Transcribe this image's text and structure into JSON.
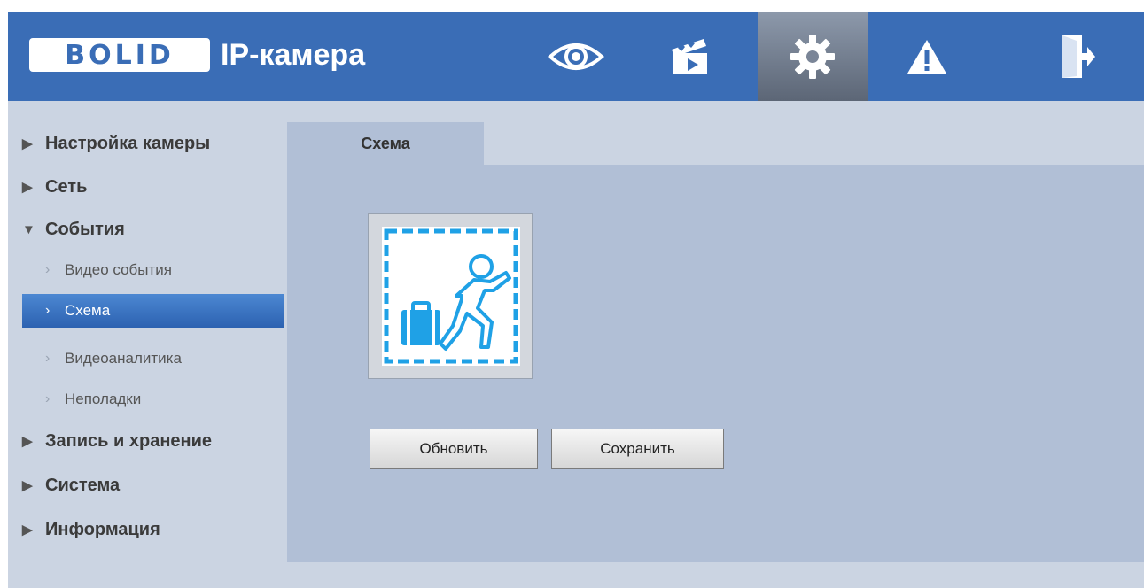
{
  "header": {
    "logo_letters": "BOLID",
    "title": "IP-камера",
    "nav": [
      {
        "icon": "eye-icon",
        "active": false
      },
      {
        "icon": "clapperboard-icon",
        "active": false
      },
      {
        "icon": "gear-icon",
        "active": true
      },
      {
        "icon": "warning-icon",
        "active": false
      },
      {
        "icon": "logout-icon",
        "active": false
      }
    ]
  },
  "sidebar": {
    "items": [
      {
        "label": "Настройка камеры",
        "expanded": false
      },
      {
        "label": "Сеть",
        "expanded": false
      },
      {
        "label": "События",
        "expanded": true,
        "children": [
          {
            "label": "Видео события",
            "active": false
          },
          {
            "label": "Схема",
            "active": true
          },
          {
            "label": "Видеоаналитика",
            "active": false
          },
          {
            "label": "Неполадки",
            "active": false
          }
        ]
      },
      {
        "label": "Запись и хранение",
        "expanded": false
      },
      {
        "label": "Система",
        "expanded": false
      },
      {
        "label": "Информация",
        "expanded": false
      }
    ]
  },
  "main": {
    "tab_label": "Схема",
    "preview_icon": "abandoned-object-icon",
    "refresh_label": "Обновить",
    "save_label": "Сохранить"
  },
  "colors": {
    "header_bg": "#3a6db6",
    "page_bg": "#cbd4e2",
    "content_bg": "#b1bfd6",
    "active_item": "#2c62b1",
    "icon_accent": "#1fa1e6"
  }
}
